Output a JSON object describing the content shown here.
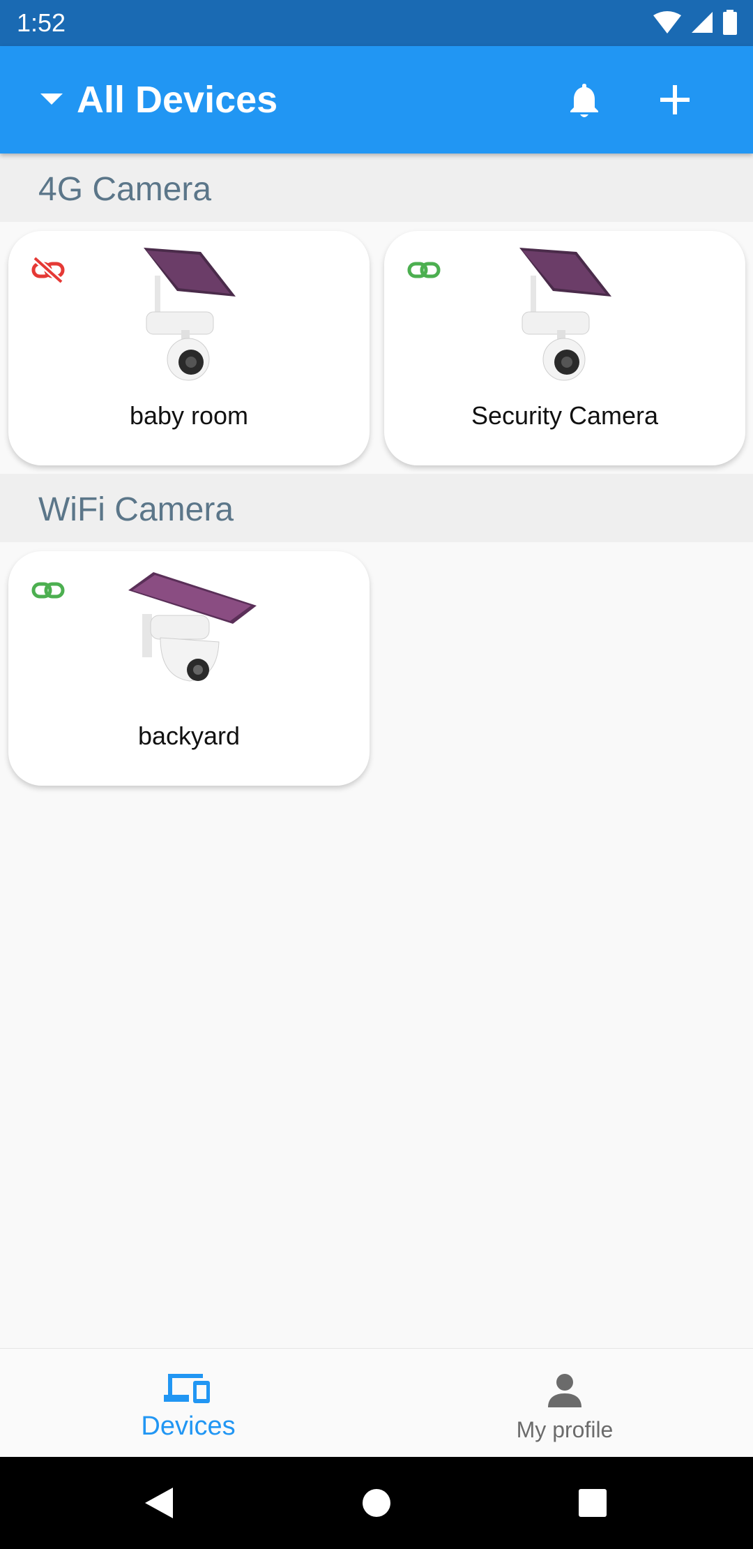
{
  "status_bar": {
    "time": "1:52",
    "icons": [
      "wifi-icon",
      "signal-icon",
      "battery-icon"
    ]
  },
  "app_bar": {
    "title": "All Devices",
    "icons": [
      "dropdown-caret-icon",
      "bell-icon",
      "plus-icon"
    ]
  },
  "sections": [
    {
      "title": "4G Camera",
      "devices": [
        {
          "name": "baby room",
          "link_status": "disconnected",
          "link_icon": "link-off-icon"
        },
        {
          "name": "Security Camera",
          "link_status": "connected",
          "link_icon": "link-icon"
        }
      ]
    },
    {
      "title": "WiFi Camera",
      "devices": [
        {
          "name": "backyard",
          "link_status": "connected",
          "link_icon": "link-icon"
        }
      ]
    }
  ],
  "bottom_nav": {
    "items": [
      {
        "label": "Devices",
        "icon": "devices-icon",
        "active": true
      },
      {
        "label": "My profile",
        "icon": "person-icon",
        "active": false
      }
    ]
  },
  "colors": {
    "status_bar": "#1a6ab3",
    "app_bar": "#2196f3",
    "accent": "#2196f3",
    "connected": "#4caf50",
    "disconnected": "#e53935",
    "section_title": "#5b7689"
  }
}
